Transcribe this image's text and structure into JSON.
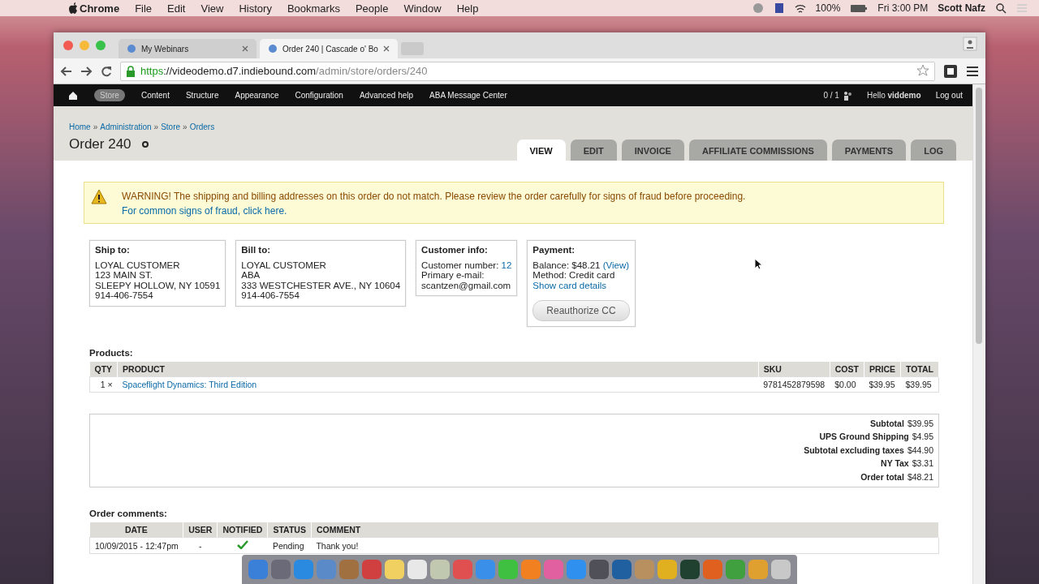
{
  "menubar": {
    "app": "Chrome",
    "menus": [
      "File",
      "Edit",
      "View",
      "History",
      "Bookmarks",
      "People",
      "Window",
      "Help"
    ],
    "battery": "100%",
    "clock": "Fri 3:00 PM",
    "user": "Scott Nafz"
  },
  "browser": {
    "tabs": [
      {
        "title": "My Webinars",
        "selected": false
      },
      {
        "title": "Order 240 | Cascade o' Bo",
        "selected": true
      }
    ],
    "url": {
      "scheme": "https",
      "host": "://videodemo.d7.indiebound.com",
      "path": "/admin/store/orders/240"
    }
  },
  "toolbar": {
    "items": [
      {
        "label": "Store",
        "selected": true
      },
      {
        "label": "Content",
        "selected": false
      },
      {
        "label": "Structure",
        "selected": false
      },
      {
        "label": "Appearance",
        "selected": false
      },
      {
        "label": "Configuration",
        "selected": false
      },
      {
        "label": "Advanced help",
        "selected": false
      },
      {
        "label": "ABA Message Center",
        "selected": false
      }
    ],
    "cart": "0 / 1",
    "hello": "Hello",
    "username": "viddemo",
    "logout": "Log out"
  },
  "breadcrumb": {
    "separator": "»",
    "items": [
      "Home",
      "Administration",
      "Store",
      "Orders"
    ]
  },
  "title": "Order 240",
  "tabs": [
    {
      "label": "VIEW",
      "selected": true
    },
    {
      "label": "EDIT",
      "selected": false
    },
    {
      "label": "INVOICE",
      "selected": false
    },
    {
      "label": "AFFILIATE COMMISSIONS",
      "selected": false
    },
    {
      "label": "PAYMENTS",
      "selected": false
    },
    {
      "label": "LOG",
      "selected": false
    }
  ],
  "warning": {
    "text": "WARNING! The shipping and billing addresses on this order do not match. Please review the order carefully for signs of fraud before proceeding.",
    "link": "For common signs of fraud, click here."
  },
  "panes": [
    {
      "title": "Ship to:",
      "lines": [
        {
          "text": "LOYAL CUSTOMER"
        },
        {
          "text": "123 MAIN ST."
        },
        {
          "text": "SLEEPY HOLLOW, NY 10591"
        },
        {
          "text": "914-406-7554"
        }
      ]
    },
    {
      "title": "Bill to:",
      "lines": [
        {
          "text": "LOYAL CUSTOMER"
        },
        {
          "text": "ABA"
        },
        {
          "text": "333 WESTCHESTER AVE., NY 10604"
        },
        {
          "text": "914-406-7554"
        }
      ]
    },
    {
      "title": "Customer info:",
      "lines": [
        {
          "text": "Customer number:",
          "link": "12"
        },
        {
          "text": "Primary e-mail:"
        },
        {
          "text": "scantzen@gmail.com"
        }
      ]
    },
    {
      "title": "Payment:",
      "lines": [
        {
          "text": "Balance: $48.21",
          "link": "(View)"
        },
        {
          "text": "Method: Credit card"
        },
        {
          "link": "Show card details"
        }
      ],
      "button": "Reauthorize CC"
    }
  ],
  "products": {
    "label": "Products:",
    "columns": [
      "QTY",
      "PRODUCT",
      "SKU",
      "COST",
      "PRICE",
      "TOTAL"
    ],
    "rows": [
      {
        "qty": "1 ×",
        "product": "Spaceflight Dynamics: Third Edition",
        "sku": "9781452879598",
        "cost": "$0.00",
        "price": "$39.95",
        "total": "$39.95"
      }
    ]
  },
  "totals": [
    {
      "label": "Subtotal",
      "value": "$39.95"
    },
    {
      "label": "UPS Ground Shipping",
      "value": "$4.95"
    },
    {
      "label": "Subtotal excluding taxes",
      "value": "$44.90"
    },
    {
      "label": "NY Tax",
      "value": "$3.31"
    },
    {
      "label": "Order total",
      "value": "$48.21"
    }
  ],
  "comments": {
    "label": "Order comments:",
    "columns": [
      "DATE",
      "USER",
      "NOTIFIED",
      "STATUS",
      "COMMENT"
    ],
    "rows": [
      {
        "date": "10/09/2015 - 12:47pm",
        "user": "-",
        "notified": true,
        "status": "Pending",
        "comment": "Thank you!"
      }
    ]
  }
}
